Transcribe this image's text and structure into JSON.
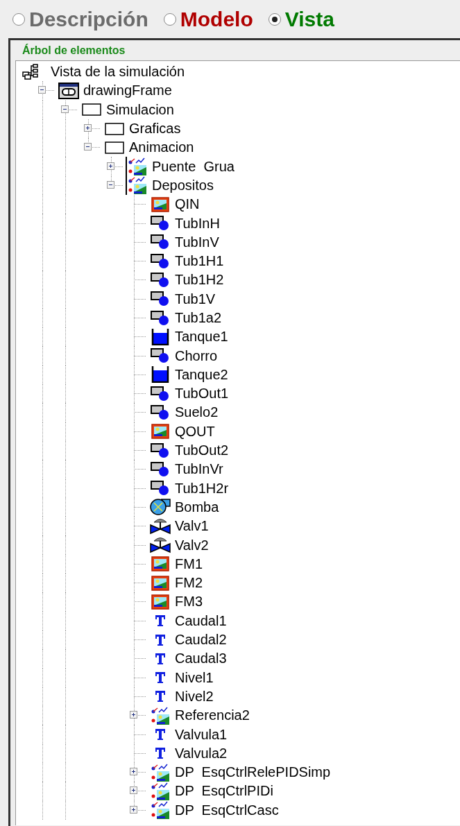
{
  "tabs": [
    {
      "label": "Descripción",
      "selected": false,
      "color": "#6b6b6b"
    },
    {
      "label": "Modelo",
      "selected": false,
      "color": "#b00000"
    },
    {
      "label": "Vista",
      "selected": true,
      "color": "#007a00"
    }
  ],
  "panel": {
    "title": "Árbol de elementos",
    "tree": {
      "label": "Vista de la simulación",
      "kind": "root",
      "children": [
        {
          "label": "drawingFrame",
          "kind": "frame",
          "expanded": true,
          "children": [
            {
              "label": "Simulacion",
              "kind": "panel",
              "expanded": true,
              "children": [
                {
                  "label": "Graficas",
                  "kind": "panel",
                  "expanded": false
                },
                {
                  "label": "Animacion",
                  "kind": "panel",
                  "expanded": true,
                  "children": [
                    {
                      "label": "Puente  Grua",
                      "kind": "drawingpanel",
                      "expanded": false
                    },
                    {
                      "label": "Depositos",
                      "kind": "drawingpanel",
                      "expanded": true,
                      "children": [
                        {
                          "label": "QIN",
                          "kind": "image"
                        },
                        {
                          "label": "TubInH",
                          "kind": "shape"
                        },
                        {
                          "label": "TubInV",
                          "kind": "shape"
                        },
                        {
                          "label": "Tub1H1",
                          "kind": "shape"
                        },
                        {
                          "label": "Tub1H2",
                          "kind": "shape"
                        },
                        {
                          "label": "Tub1V",
                          "kind": "shape"
                        },
                        {
                          "label": "Tub1a2",
                          "kind": "shape"
                        },
                        {
                          "label": "Tanque1",
                          "kind": "tank"
                        },
                        {
                          "label": "Chorro",
                          "kind": "shape"
                        },
                        {
                          "label": "Tanque2",
                          "kind": "tank"
                        },
                        {
                          "label": "TubOut1",
                          "kind": "shape"
                        },
                        {
                          "label": "Suelo2",
                          "kind": "shape"
                        },
                        {
                          "label": "QOUT",
                          "kind": "image"
                        },
                        {
                          "label": "TubOut2",
                          "kind": "shape"
                        },
                        {
                          "label": "TubInVr",
                          "kind": "shape"
                        },
                        {
                          "label": "Tub1H2r",
                          "kind": "shape"
                        },
                        {
                          "label": "Bomba",
                          "kind": "pump"
                        },
                        {
                          "label": "Valv1",
                          "kind": "valve"
                        },
                        {
                          "label": "Valv2",
                          "kind": "valve"
                        },
                        {
                          "label": "FM1",
                          "kind": "image"
                        },
                        {
                          "label": "FM2",
                          "kind": "image"
                        },
                        {
                          "label": "FM3",
                          "kind": "image"
                        },
                        {
                          "label": "Caudal1",
                          "kind": "text"
                        },
                        {
                          "label": "Caudal2",
                          "kind": "text"
                        },
                        {
                          "label": "Caudal3",
                          "kind": "text"
                        },
                        {
                          "label": "Nivel1",
                          "kind": "text"
                        },
                        {
                          "label": "Nivel2",
                          "kind": "text"
                        },
                        {
                          "label": "Referencia2",
                          "kind": "group",
                          "expanded": false
                        },
                        {
                          "label": "Valvula1",
                          "kind": "text"
                        },
                        {
                          "label": "Valvula2",
                          "kind": "text"
                        },
                        {
                          "label": "DP  EsqCtrlRelePIDSimp",
                          "kind": "group",
                          "expanded": false
                        },
                        {
                          "label": "DP  EsqCtrlPIDi",
                          "kind": "group",
                          "expanded": false
                        },
                        {
                          "label": "DP  EsqCtrlCasc",
                          "kind": "group",
                          "expanded": false
                        }
                      ]
                    }
                  ]
                }
              ]
            }
          ]
        }
      ]
    }
  }
}
